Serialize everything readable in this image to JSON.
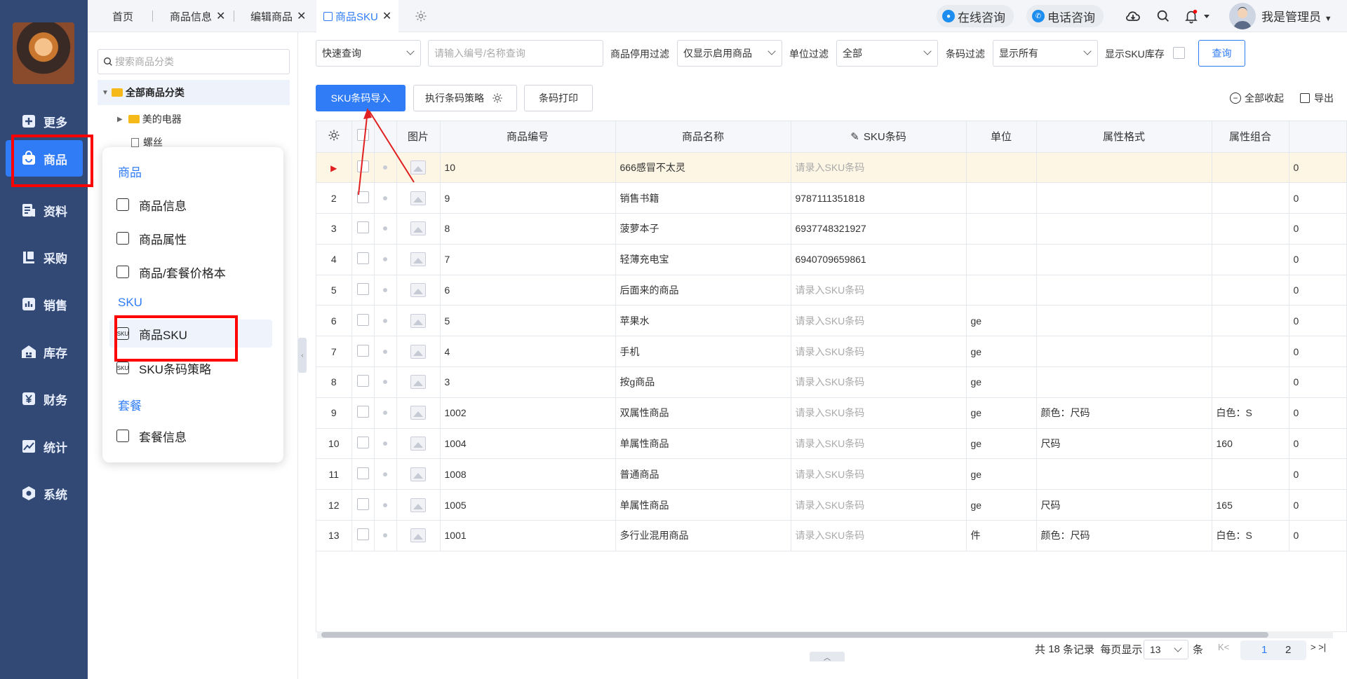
{
  "tabs": [
    {
      "label": "首页",
      "closable": false
    },
    {
      "label": "商品信息",
      "closable": true
    },
    {
      "label": "编辑商品",
      "closable": true
    },
    {
      "label": "商品SKU",
      "closable": true,
      "active": true
    }
  ],
  "header": {
    "online_consult": "在线咨询",
    "phone_consult": "电话咨询",
    "user_name": "我是管理员"
  },
  "leftnav": [
    {
      "label": "更多",
      "icon": "plus-square-icon"
    },
    {
      "label": "商品",
      "icon": "shopping-bag-icon",
      "active": true
    },
    {
      "label": "资料",
      "icon": "document-icon"
    },
    {
      "label": "采购",
      "icon": "purchase-icon"
    },
    {
      "label": "销售",
      "icon": "bar-chart-icon"
    },
    {
      "label": "库存",
      "icon": "warehouse-icon"
    },
    {
      "label": "财务",
      "icon": "yen-icon"
    },
    {
      "label": "统计",
      "icon": "trend-chart-icon"
    },
    {
      "label": "系统",
      "icon": "hexagon-gear-icon"
    }
  ],
  "category": {
    "search_placeholder": "搜索商品分类",
    "root": "全部商品分类",
    "children": [
      "美的电器",
      "螺丝"
    ]
  },
  "menu": {
    "section1": "商品",
    "item1": "商品信息",
    "item2": "商品属性",
    "item3": "商品/套餐价格本",
    "section2": "SKU",
    "item4": "商品SKU",
    "item5": "SKU条码策略",
    "section3": "套餐",
    "item6": "套餐信息"
  },
  "filters": {
    "quick_query": "快速查询",
    "search_placeholder": "请输入编号/名称查询",
    "disabled_filter_label": "商品停用过滤",
    "disabled_filter_value": "仅显示启用商品",
    "unit_filter_label": "单位过滤",
    "unit_filter_value": "全部",
    "barcode_filter_label": "条码过滤",
    "barcode_filter_value": "显示所有",
    "show_stock_label": "显示SKU库存",
    "query_btn": "查询"
  },
  "toolbar": {
    "import_btn": "SKU条码导入",
    "strategy_btn": "执行条码策略",
    "print_btn": "条码打印",
    "collapse_all": "全部收起",
    "export": "导出"
  },
  "table": {
    "columns": [
      "图片",
      "商品编号",
      "商品名称",
      "SKU条码",
      "单位",
      "属性格式",
      "属性组合"
    ],
    "barcode_placeholder": "请录入SKU条码",
    "rows": [
      {
        "idx": "▶",
        "code": "10",
        "name": "666感冒不太灵",
        "barcode": "",
        "unit": "",
        "attr": "",
        "combo": "",
        "last": "0"
      },
      {
        "idx": "2",
        "code": "9",
        "name": "销售书籍",
        "barcode": "9787111351818",
        "unit": "",
        "attr": "",
        "combo": "",
        "last": "0"
      },
      {
        "idx": "3",
        "code": "8",
        "name": "菠萝本子",
        "barcode": "6937748321927",
        "unit": "",
        "attr": "",
        "combo": "",
        "last": "0"
      },
      {
        "idx": "4",
        "code": "7",
        "name": "轻薄充电宝",
        "barcode": "6940709659861",
        "unit": "",
        "attr": "",
        "combo": "",
        "last": "0"
      },
      {
        "idx": "5",
        "code": "6",
        "name": "后面来的商品",
        "barcode": "",
        "unit": "",
        "attr": "",
        "combo": "",
        "last": "0"
      },
      {
        "idx": "6",
        "code": "5",
        "name": "苹果水",
        "barcode": "",
        "unit": "ge",
        "attr": "",
        "combo": "",
        "last": "0"
      },
      {
        "idx": "7",
        "code": "4",
        "name": "手机",
        "barcode": "",
        "unit": "ge",
        "attr": "",
        "combo": "",
        "last": "0"
      },
      {
        "idx": "8",
        "code": "3",
        "name": "按g商品",
        "barcode": "",
        "unit": "ge",
        "attr": "",
        "combo": "",
        "last": "0"
      },
      {
        "idx": "9",
        "code": "1002",
        "name": "双属性商品",
        "barcode": "",
        "unit": "ge",
        "attr": "颜色：尺码",
        "combo": "白色：S",
        "last": "0"
      },
      {
        "idx": "10",
        "code": "1004",
        "name": "单属性商品",
        "barcode": "",
        "unit": "ge",
        "attr": "尺码",
        "combo": "160",
        "last": "0"
      },
      {
        "idx": "11",
        "code": "1008",
        "name": "普通商品",
        "barcode": "",
        "unit": "ge",
        "attr": "",
        "combo": "",
        "last": "0"
      },
      {
        "idx": "12",
        "code": "1005",
        "name": "单属性商品",
        "barcode": "",
        "unit": "ge",
        "attr": "尺码",
        "combo": "165",
        "last": "0"
      },
      {
        "idx": "13",
        "code": "1001",
        "name": "多行业混用商品",
        "barcode": "",
        "unit": "件",
        "attr": "颜色：尺码",
        "combo": "白色：S",
        "last": "0"
      }
    ]
  },
  "pager": {
    "total_prefix": "共",
    "total": "18",
    "total_suffix": "条记录",
    "per_page_label": "每页显示",
    "per_page": "13",
    "unit": "条",
    "page1": "1",
    "page2": "2"
  },
  "colors": {
    "primary": "#2f7cf6",
    "nav_bg": "#324976",
    "highlight": "#ff0000"
  }
}
